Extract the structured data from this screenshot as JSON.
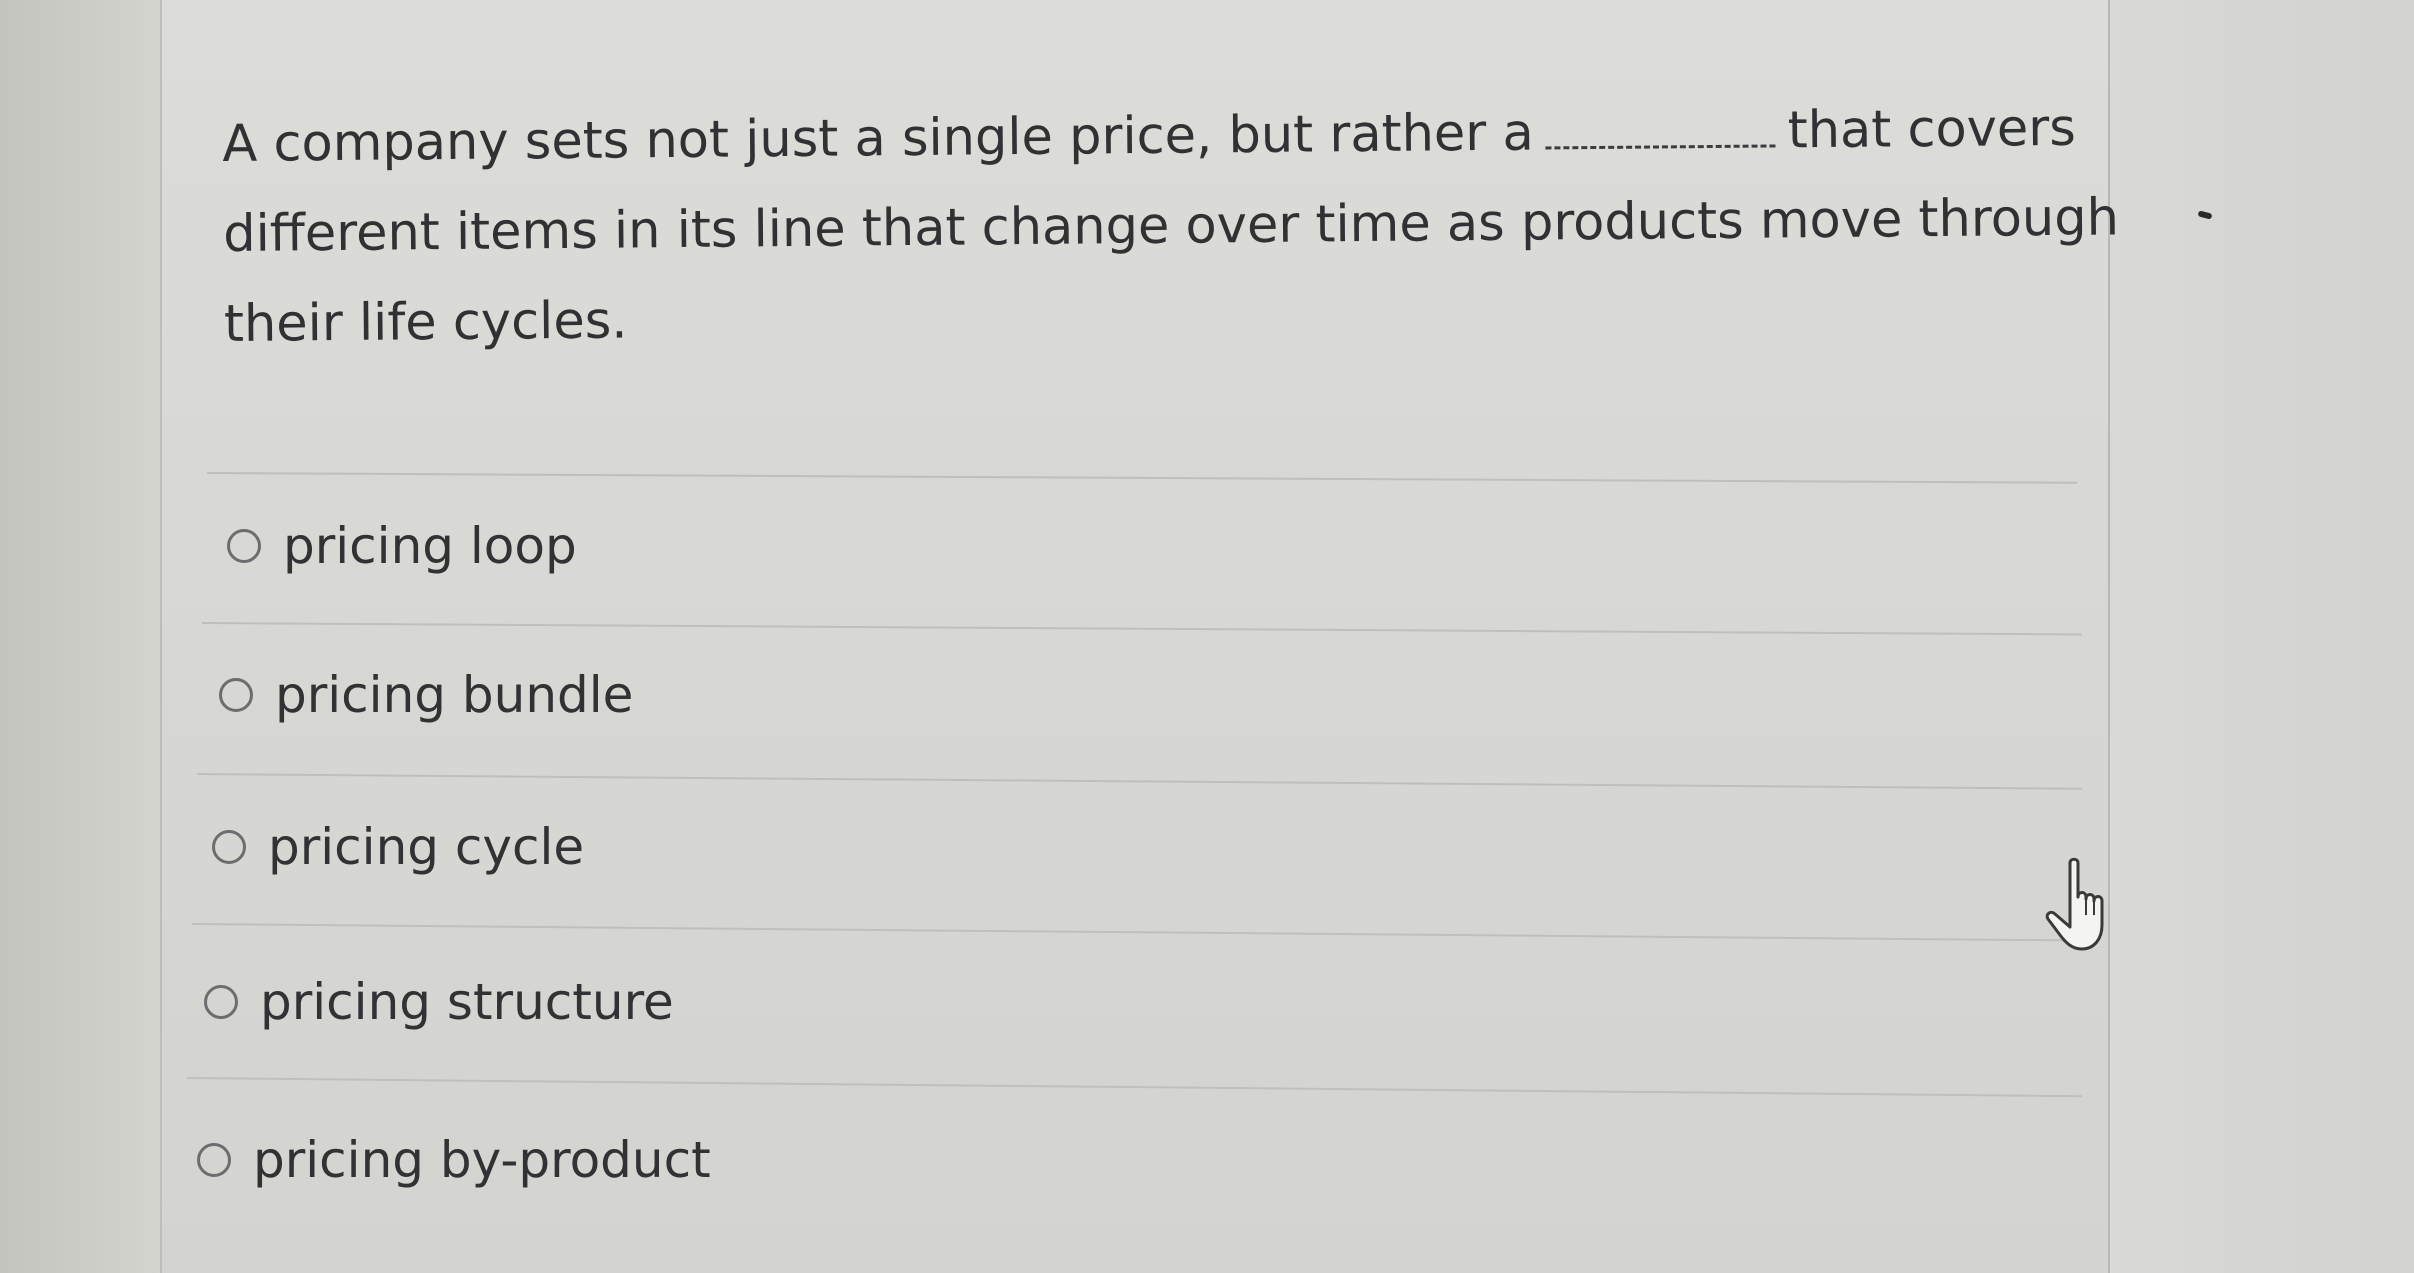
{
  "question": {
    "text_before_blank": "A company sets not just a single price, but rather a",
    "text_after_blank": "that covers different items in its line that change over time as products move through their life cycles."
  },
  "options": [
    {
      "label": "pricing loop",
      "selected": false
    },
    {
      "label": "pricing bundle",
      "selected": false
    },
    {
      "label": "pricing cycle",
      "selected": false
    },
    {
      "label": "pricing structure",
      "selected": false
    },
    {
      "label": "pricing by-product",
      "selected": false
    }
  ],
  "cursor_icon": "hand-pointer-icon"
}
